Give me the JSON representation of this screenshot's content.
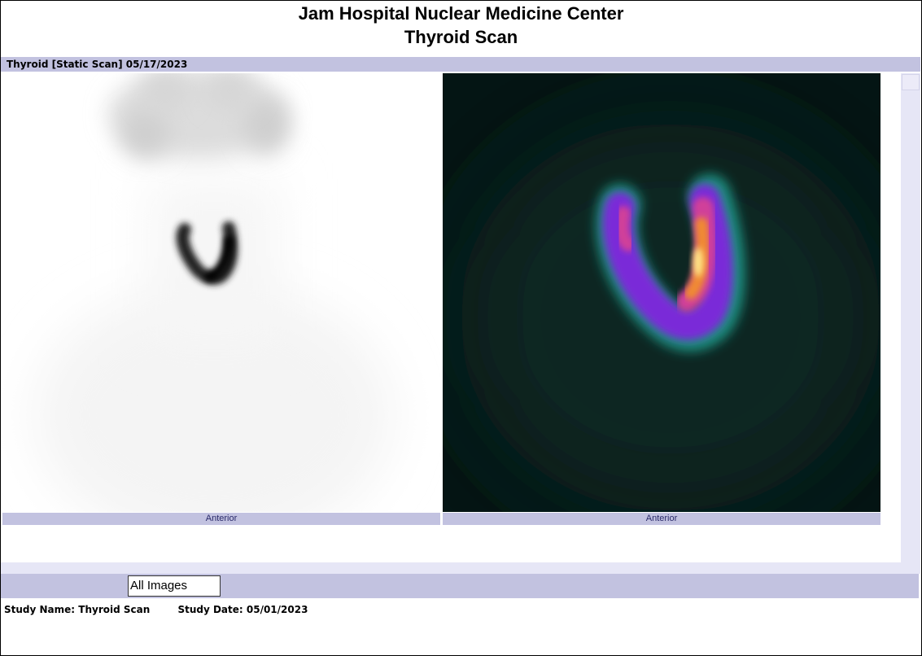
{
  "header": {
    "title_line1": "Jam Hospital Nuclear Medicine Center",
    "title_line2": "Thyroid Scan"
  },
  "study_bar": {
    "label": "Thyroid [Static Scan] 05/17/2023"
  },
  "images": [
    {
      "caption": "Anterior",
      "colormap": "grayscale-inverted"
    },
    {
      "caption": "Anterior",
      "colormap": "hot-spectrum"
    }
  ],
  "image_selector": {
    "value": "All Images"
  },
  "footer": {
    "study_name": "Study Name: Thyroid Scan",
    "study_date": "Study Date: 05/01/2023"
  }
}
